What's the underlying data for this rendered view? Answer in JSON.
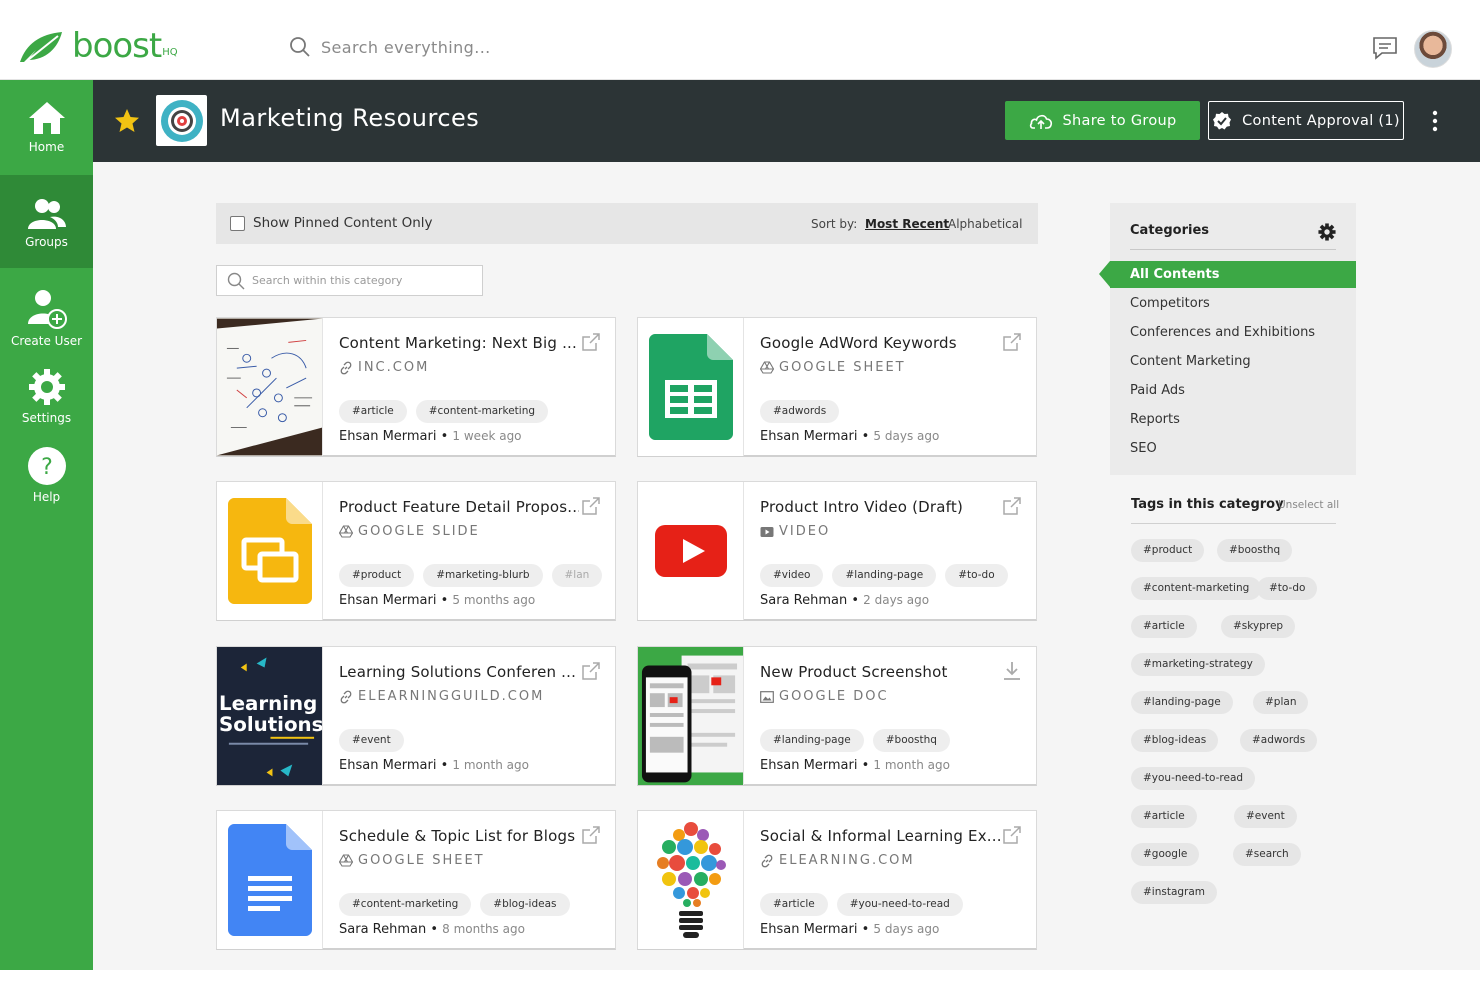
{
  "brand": {
    "name": "boost",
    "suffix": "HQ",
    "color": "#3ca845"
  },
  "top_search": {
    "placeholder": "Search everything..."
  },
  "sidebar": {
    "items": [
      {
        "label": "Home",
        "icon": "home-icon"
      },
      {
        "label": "Groups",
        "icon": "groups-icon",
        "active": true
      },
      {
        "label": "Create User",
        "icon": "add-user-icon"
      },
      {
        "label": "Settings",
        "icon": "gear-icon"
      },
      {
        "label": "Help",
        "icon": "help-icon"
      }
    ]
  },
  "header": {
    "title": "Marketing Resources",
    "share_label": "Share to Group",
    "approval_label": "Content Approval (1)"
  },
  "filter": {
    "pinned_label": "Show Pinned Content Only",
    "sort_by": "Sort by:",
    "sort_recent": "Most Recent",
    "sort_alpha": "Alphabetical",
    "search_placeholder": "Search within this category"
  },
  "cards": [
    {
      "title": "Content Marketing: Next Big ...",
      "source": "INC.COM",
      "source_icon": "link-icon",
      "tags": [
        "#article",
        "#content-marketing"
      ],
      "author": "Ehsan Mermari",
      "ago": "1 week ago",
      "action": "external-link-icon"
    },
    {
      "title": "Google AdWord Keywords",
      "source": "GOOGLE SHEET",
      "source_icon": "drive-icon",
      "tags": [
        "#adwords"
      ],
      "author": "Ehsan Mermari",
      "ago": "5 days ago",
      "action": "external-link-icon"
    },
    {
      "title": "Product Feature Detail Propos...",
      "source": "GOOGLE SLIDE",
      "source_icon": "drive-icon",
      "tags": [
        "#product",
        "#marketing-blurb",
        "#lan"
      ],
      "author": "Ehsan Mermari",
      "ago": "5 months ago",
      "action": "external-link-icon"
    },
    {
      "title": "Product Intro Video (Draft)",
      "source": "VIDEO",
      "source_icon": "video-icon",
      "tags": [
        "#video",
        "#landing-page",
        "#to-do"
      ],
      "author": "Sara Rehman",
      "ago": "2 days ago",
      "action": "external-link-icon"
    },
    {
      "title": "Learning Solutions Conferen ...",
      "source": "ELEARNINGGUILD.COM",
      "source_icon": "link-icon",
      "tags": [
        "#event"
      ],
      "author": "Ehsan Mermari",
      "ago": "1 month ago",
      "action": "external-link-icon"
    },
    {
      "title": "New Product Screenshot",
      "source": "GOOGLE DOC",
      "source_icon": "image-icon",
      "tags": [
        "#landing-page",
        "#boosthq"
      ],
      "author": "Ehsan Mermari",
      "ago": "1 month ago",
      "action": "download-icon"
    },
    {
      "title": "Schedule & Topic List for Blogs",
      "source": "GOOGLE SHEET",
      "source_icon": "drive-icon",
      "tags": [
        "#content-marketing",
        "#blog-ideas"
      ],
      "author": "Sara Rehman",
      "ago": "8 months ago",
      "action": "external-link-icon"
    },
    {
      "title": "Social & Informal Learning Ex...",
      "source": "ELEARNING.COM",
      "source_icon": "link-icon",
      "tags": [
        "#article",
        "#you-need-to-read"
      ],
      "author": "Ehsan Mermari",
      "ago": "5 days ago",
      "action": "external-link-icon"
    }
  ],
  "thumbnails": {
    "learning_line1": "Learning",
    "learning_line2": "Solutions"
  },
  "categories": {
    "heading": "Categories",
    "items": [
      "All Contents",
      "Competitors",
      "Conferences and Exhibitions",
      "Content Marketing",
      "Paid Ads",
      "Reports",
      "SEO"
    ],
    "selected": "All Contents"
  },
  "tags_panel": {
    "heading": "Tags in this categroy",
    "unselect": "Unselect all",
    "tags": [
      "#product",
      "#boosthq",
      "#content-marketing",
      "#to-do",
      "#article",
      "#skyprep",
      "#marketing-strategy",
      "#landing-page",
      "#plan",
      "#blog-ideas",
      "#adwords",
      "#you-need-to-read",
      "#article",
      "#event",
      "#google",
      "#search",
      "#instagram"
    ]
  }
}
